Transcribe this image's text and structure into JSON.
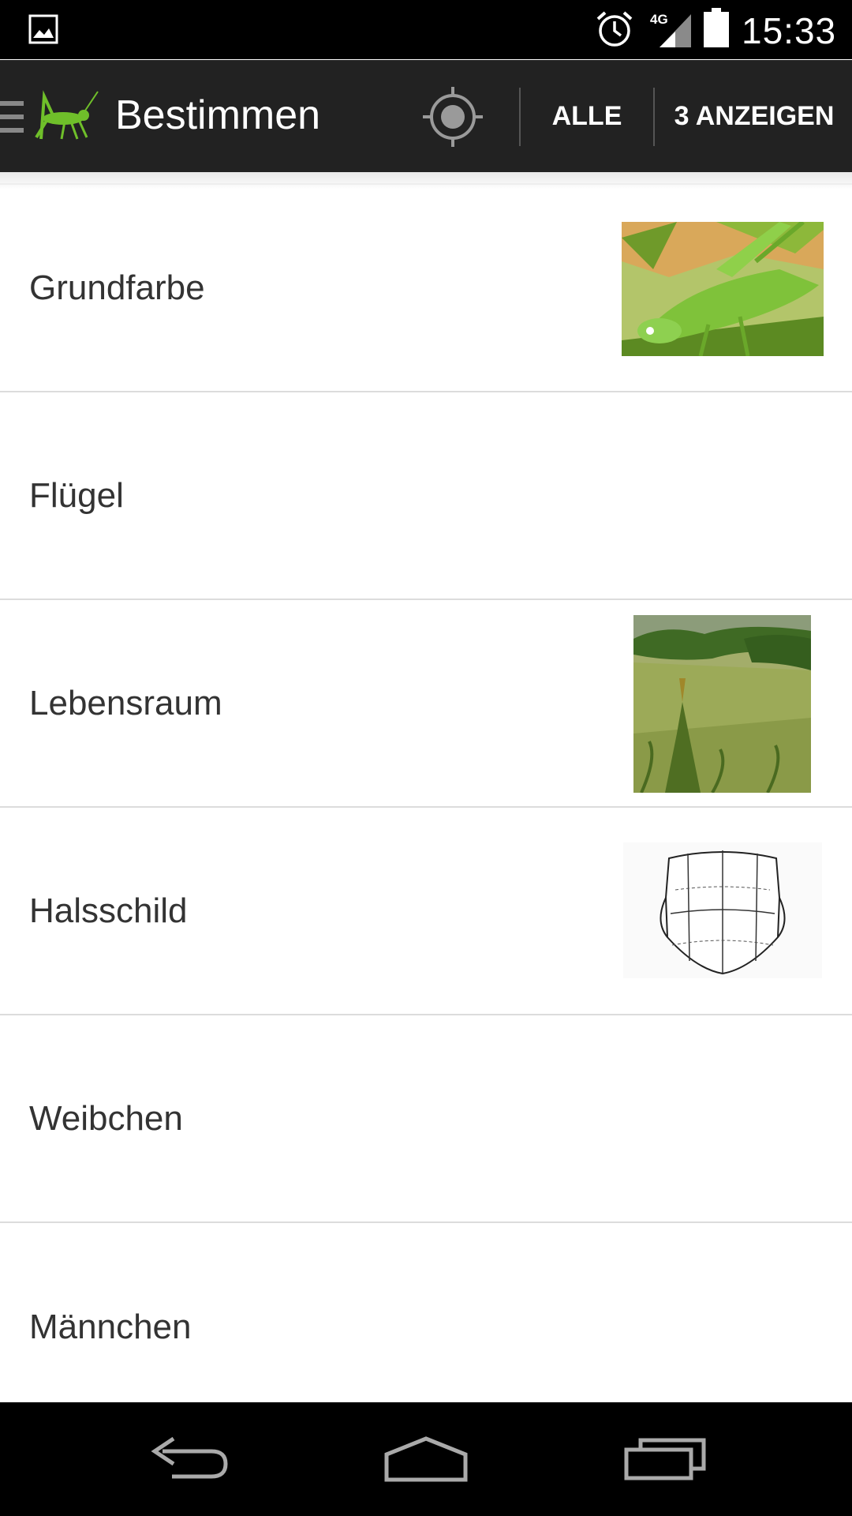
{
  "status_bar": {
    "time": "15:33",
    "network_label": "4G",
    "icons": [
      "gallery-icon",
      "alarm-icon",
      "signal-icon",
      "battery-icon"
    ]
  },
  "action_bar": {
    "title": "Bestimmen",
    "alle_label": "ALLE",
    "show_label": "3 ANZEIGEN",
    "icons": [
      "drawer-icon",
      "grasshopper-logo",
      "locate-icon"
    ],
    "accent_color": "#6fbf2a"
  },
  "list": {
    "items": [
      {
        "label": "Grundfarbe",
        "thumbnail": "green-grasshopper-photo"
      },
      {
        "label": "Flügel",
        "thumbnail": null
      },
      {
        "label": "Lebensraum",
        "thumbnail": "meadow-habitat-photo"
      },
      {
        "label": "Halsschild",
        "thumbnail": "pronotum-drawing"
      },
      {
        "label": "Weibchen",
        "thumbnail": null
      },
      {
        "label": "Männchen",
        "thumbnail": null
      }
    ]
  },
  "nav_bar": {
    "icons": [
      "back-icon",
      "home-icon",
      "recents-icon"
    ]
  }
}
